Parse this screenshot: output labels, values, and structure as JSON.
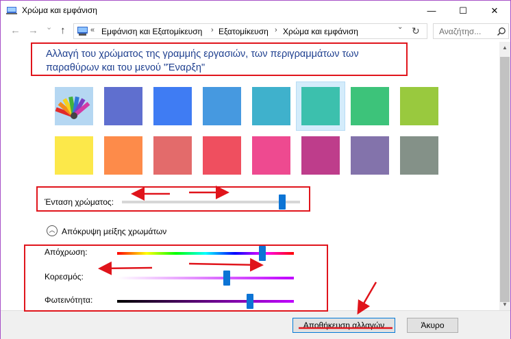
{
  "window": {
    "title": "Χρώμα και εμφάνιση",
    "minimize": "—",
    "maximize": "☐",
    "close": "✕"
  },
  "nav": {
    "back": "←",
    "forward": "→",
    "recent": "⌄",
    "up": "↑",
    "breadcrumb": [
      "«",
      "Εμφάνιση και Εξατομίκευση",
      "›",
      "Εξατομίκευση",
      "›",
      "Χρώμα και εμφάνιση"
    ],
    "dropdown": "⌄",
    "refresh": "↻",
    "search_placeholder": "Αναζήτησ..."
  },
  "main": {
    "heading": "Αλλαγή του χρώματος της γραμμής εργασιών, των περιγραμμάτων των παραθύρων και του μενού \"Έναρξη\"",
    "swatches": [
      "#5f6fcf",
      "#3f7cf3",
      "#4699e0",
      "#3fb1cc",
      "#3cc0ad",
      "#3dc37a",
      "#99c93e",
      "#fce84a",
      "#fd8b4a",
      "#e36b6b",
      "#ef4f5f",
      "#ee4a90",
      "#be3d8b",
      "#8373ab",
      "#849188"
    ],
    "selected_swatch": "#3cc0ad",
    "intensity_label": "Ένταση χρώματος:",
    "intensity_level": 0.9,
    "mixer_toggle": "Απόκρυψη μείξης χρωμάτων",
    "hue_label": "Απόχρωση:",
    "hue_level": 0.82,
    "saturation_label": "Κορεσμός:",
    "saturation_level": 0.62,
    "brightness_label": "Φωτεινότητα:",
    "brightness_level": 0.75
  },
  "footer": {
    "save": "Αποθήκευση αλλαγών",
    "cancel": "Άκυρο"
  },
  "colors": {
    "annotation_red": "#e0141b",
    "window_border": "#a64fc7",
    "heading_blue": "#1e3f8f",
    "thumb_blue": "#0c74d5"
  }
}
